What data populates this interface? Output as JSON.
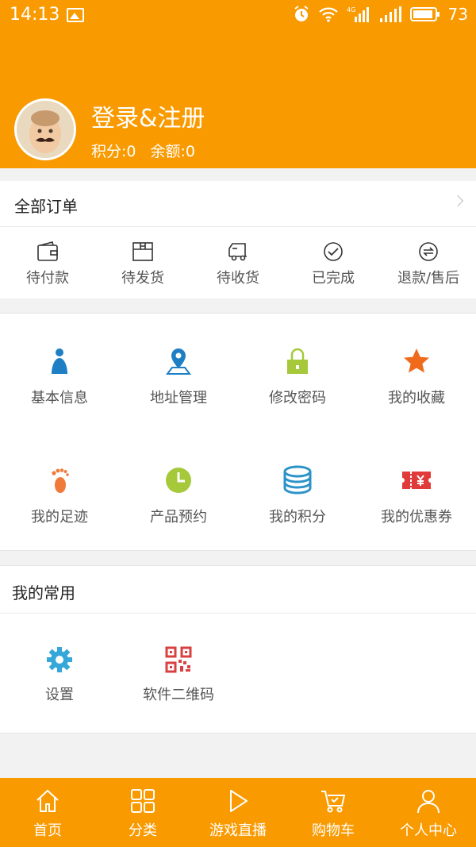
{
  "status_bar": {
    "time": "14:13",
    "network": "4G",
    "battery": "73"
  },
  "profile": {
    "login_label": "登录&注册",
    "points": "积分:0",
    "balance": "余额:0"
  },
  "orders": {
    "title": "全部订单",
    "items": [
      {
        "label": "待付款",
        "icon": "wallet-icon"
      },
      {
        "label": "待发货",
        "icon": "box-icon"
      },
      {
        "label": "待收货",
        "icon": "truck-icon"
      },
      {
        "label": "已完成",
        "icon": "check-circle-icon"
      },
      {
        "label": "退款/售后",
        "icon": "refund-icon"
      }
    ]
  },
  "features": [
    {
      "label": "基本信息",
      "icon": "person-icon",
      "color": "#1f7fc4"
    },
    {
      "label": "地址管理",
      "icon": "location-pin-icon",
      "color": "#1f7fc4"
    },
    {
      "label": "修改密码",
      "icon": "padlock-icon",
      "color": "#a5c93a"
    },
    {
      "label": "我的收藏",
      "icon": "star-icon",
      "color": "#f06a1c"
    },
    {
      "label": "我的足迹",
      "icon": "footprint-icon",
      "color": "#f07a3a"
    },
    {
      "label": "产品预约",
      "icon": "clock-icon",
      "color": "#a5c93a"
    },
    {
      "label": "我的积分",
      "icon": "coin-stack-icon",
      "color": "#2c93c8"
    },
    {
      "label": "我的优惠券",
      "icon": "coupon-icon",
      "color": "#e13a3a"
    }
  ],
  "common": {
    "title": "我的常用",
    "items": [
      {
        "label": "设置",
        "icon": "gear-icon",
        "color": "#35a7d8"
      },
      {
        "label": "软件二维码",
        "icon": "qr-code-icon",
        "color": "#d94040"
      }
    ]
  },
  "tabbar": [
    {
      "label": "首页",
      "icon": "home-icon"
    },
    {
      "label": "分类",
      "icon": "grid-icon"
    },
    {
      "label": "游戏直播",
      "icon": "play-icon"
    },
    {
      "label": "购物车",
      "icon": "cart-icon"
    },
    {
      "label": "个人中心",
      "icon": "user-icon"
    }
  ],
  "colors": {
    "brand": "#f99a00",
    "background": "#f2f2f2"
  }
}
